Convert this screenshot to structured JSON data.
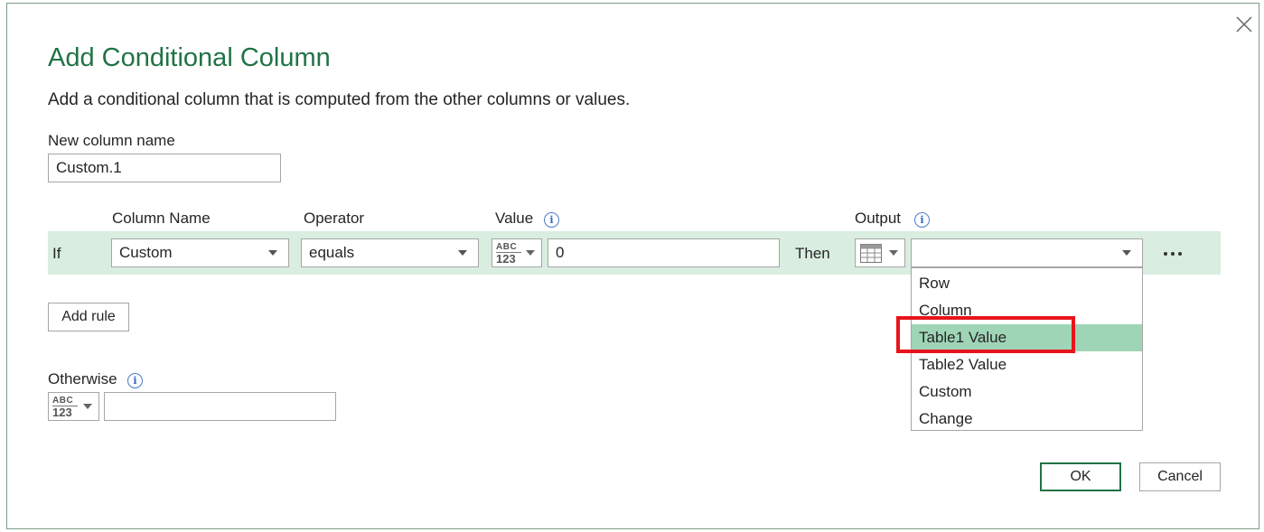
{
  "dialog": {
    "title": "Add Conditional Column",
    "subtitle": "Add a conditional column that is computed from the other columns or values."
  },
  "new_column": {
    "label": "New column name",
    "value": "Custom.1"
  },
  "headers": {
    "column_name": "Column Name",
    "operator": "Operator",
    "value": "Value",
    "output": "Output"
  },
  "rule": {
    "if_label": "If",
    "column_name": "Custom",
    "operator": "equals",
    "value_type_icon": "abc-123-type-icon",
    "value": "0",
    "then_label": "Then",
    "output_type_icon": "table-icon",
    "output_value": ""
  },
  "type_icon_text": {
    "top": "ABC",
    "bottom": "123"
  },
  "output_dropdown": {
    "options": [
      "Row",
      "Column",
      "Table1 Value",
      "Table2 Value",
      "Custom",
      "Change"
    ],
    "selected": "Table1 Value"
  },
  "add_rule_label": "Add rule",
  "otherwise": {
    "label": "Otherwise",
    "value": ""
  },
  "buttons": {
    "ok": "OK",
    "cancel": "Cancel"
  },
  "info_glyph": "i",
  "colors": {
    "accent": "#217346",
    "row_highlight": "#d9ede0",
    "selected_option": "#9fd5b7",
    "annotation_red": "#e8141b"
  }
}
